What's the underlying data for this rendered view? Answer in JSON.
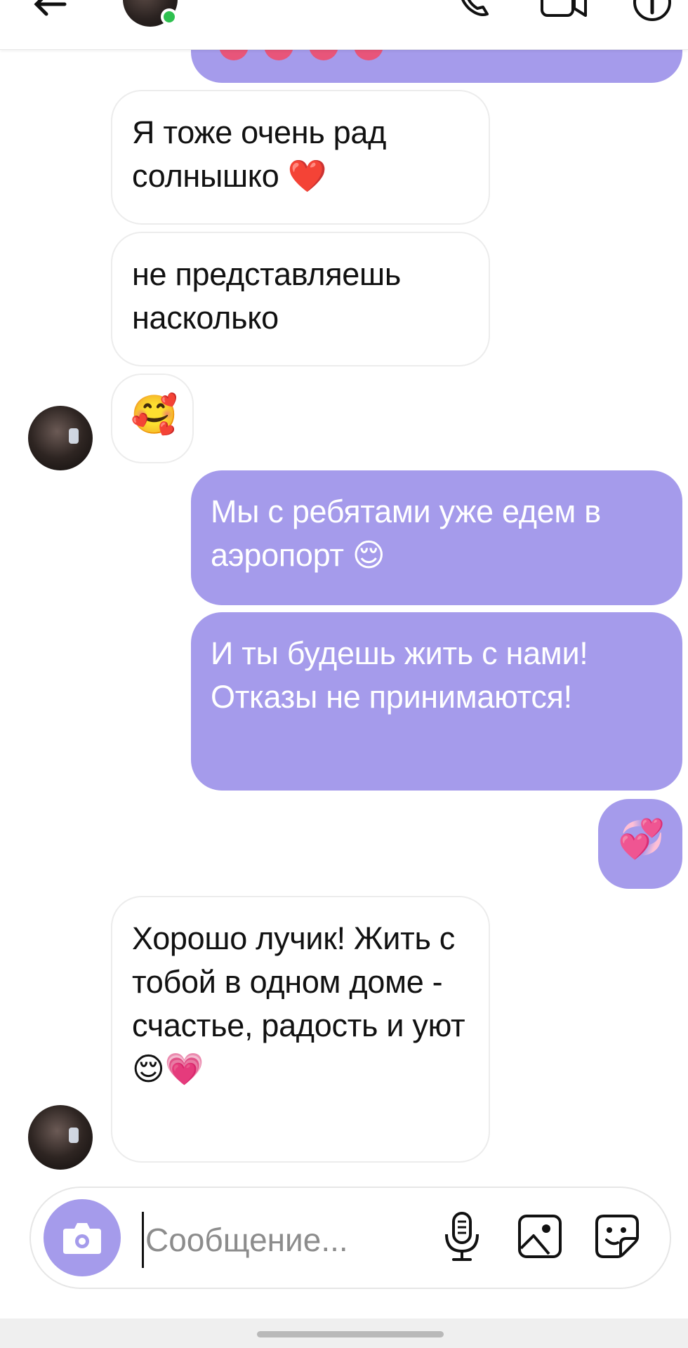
{
  "header": {
    "back_icon": "arrow-left-icon",
    "online_status_color": "#2ec04f",
    "call_icon": "phone-icon",
    "video_icon": "video-camera-icon",
    "info_icon": "info-icon"
  },
  "messages": [
    {
      "id": "m0",
      "direction": "outgoing",
      "text": "💗💗💗💗"
    },
    {
      "id": "m1",
      "direction": "incoming",
      "text": "Я тоже очень рад солнышко ❤️"
    },
    {
      "id": "m2",
      "direction": "incoming",
      "text": "не представляешь насколько"
    },
    {
      "id": "m3",
      "direction": "incoming",
      "text": "🥰"
    },
    {
      "id": "m4",
      "direction": "outgoing",
      "text": "Мы с ребятами уже едем в аэропорт 😌"
    },
    {
      "id": "m5",
      "direction": "outgoing",
      "text": "И ты будешь жить с нами! Отказы не принимаются!"
    },
    {
      "id": "m6",
      "direction": "outgoing",
      "text": "💞"
    },
    {
      "id": "m7",
      "direction": "incoming",
      "text": "Хорошо лучик! Жить с тобой в одном доме - счастье, радость и уют 😌💗"
    }
  ],
  "composer": {
    "placeholder": "Сообщение...",
    "value": "",
    "camera_icon": "camera-icon",
    "mic_icon": "microphone-icon",
    "gallery_icon": "image-icon",
    "sticker_icon": "sticker-icon"
  },
  "colors": {
    "outgoing_bubble": "#a59beb",
    "incoming_bubble": "#ffffff",
    "incoming_border": "#ececec"
  }
}
